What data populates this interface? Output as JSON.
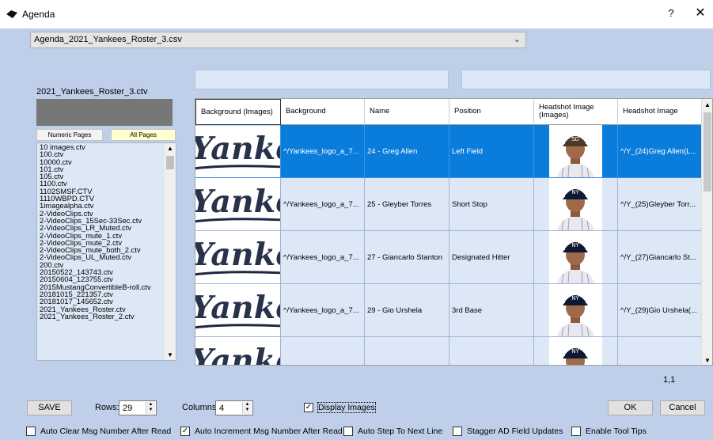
{
  "window": {
    "title": "Agenda",
    "help_label": "?",
    "close_label": "✕"
  },
  "file_combo": {
    "value": "Agenda_2021_Yankees_Roster_3.csv"
  },
  "file_label": "2021_Yankees_Roster_3.ctv",
  "page_buttons": {
    "numeric": "Numeric Pages",
    "all": "All Pages"
  },
  "file_list": [
    "10 images.ctv",
    "100.ctv",
    "10000.ctv",
    "101.ctv",
    "105.ctv",
    "1100.ctv",
    "1102SMSF.CTV",
    "1110WBPD.CTV",
    "1imagealpha.ctv",
    "2-VideoClips.ctv",
    "2-VideoClips_15Sec-33Sec.ctv",
    "2-VideoClips_LR_Muted.ctv",
    "2-VideoClips_mute_1.ctv",
    "2-VideoClips_mute_2.ctv",
    "2-VideoClips_mute_both_2.ctv",
    "2-VideoClips_UL_Muted.ctv",
    "200.ctv",
    "20150522_143743.ctv",
    "20150604_123755.ctv",
    "2015MustangConvertibleB-roll.ctv",
    "20181015_221357.ctv",
    "20181017_145652.ctv",
    "2021_Yankees_Roster.ctv",
    "2021_Yankees_Roster_2.ctv"
  ],
  "grid": {
    "headers": [
      "Background (Images)",
      "Background",
      "Name",
      "Position",
      "Headshot Image (Images)",
      "Headshot Image"
    ],
    "rows": [
      {
        "background": "^/Yankees_logo_a_7...",
        "name": "24 - Greg Allen",
        "position": "Left Field",
        "headshot": "^/Y_(24)Greg Allen(L...",
        "cap": "padres",
        "selected": true
      },
      {
        "background": "^/Yankees_logo_a_7...",
        "name": "25 - Gleyber Torres",
        "position": "Short Stop",
        "headshot": "^/Y_(25)Gleyber Torr...",
        "cap": "yankees",
        "selected": false
      },
      {
        "background": "^/Yankees_logo_a_7...",
        "name": "27 - Giancarlo Stanton",
        "position": "Designated Hitter",
        "headshot": "^/Y_(27)Giancarlo St...",
        "cap": "yankees",
        "selected": false
      },
      {
        "background": "^/Yankees_logo_a_7...",
        "name": "29 - Gio Urshela",
        "position": "3rd Base",
        "headshot": "^/Y_(29)Gio Urshela(...",
        "cap": "yankees",
        "selected": false
      },
      {
        "background": "",
        "name": "",
        "position": "",
        "headshot": "",
        "cap": "yankees",
        "selected": false
      }
    ]
  },
  "position_readout": "1,1",
  "bottom": {
    "save_label": "SAVE",
    "rows_label": "Rows:",
    "rows_value": "29",
    "columns_label": "Columns:",
    "columns_value": "4",
    "display_images_label": "Display Images",
    "display_images_checked": true,
    "ok_label": "OK",
    "cancel_label": "Cancel"
  },
  "options": [
    {
      "label": "Auto Clear Msg Number After Read",
      "checked": false
    },
    {
      "label": "Auto Increment Msg Number After Read",
      "checked": true
    },
    {
      "label": "Auto Step To Next Line",
      "checked": false
    },
    {
      "label": "Stagger AD Field Updates",
      "checked": false
    },
    {
      "label": "Enable Tool Tips",
      "checked": false
    }
  ],
  "colors": {
    "client_bg": "#bfcfea",
    "selection": "#0a7cdc",
    "row_bg": "#dde8f7",
    "yankees_navy": "#1c2841"
  },
  "icons": {
    "app": "app-logo-icon",
    "dropdown": "chevron-down-icon",
    "close": "close-icon",
    "help": "help-icon"
  }
}
